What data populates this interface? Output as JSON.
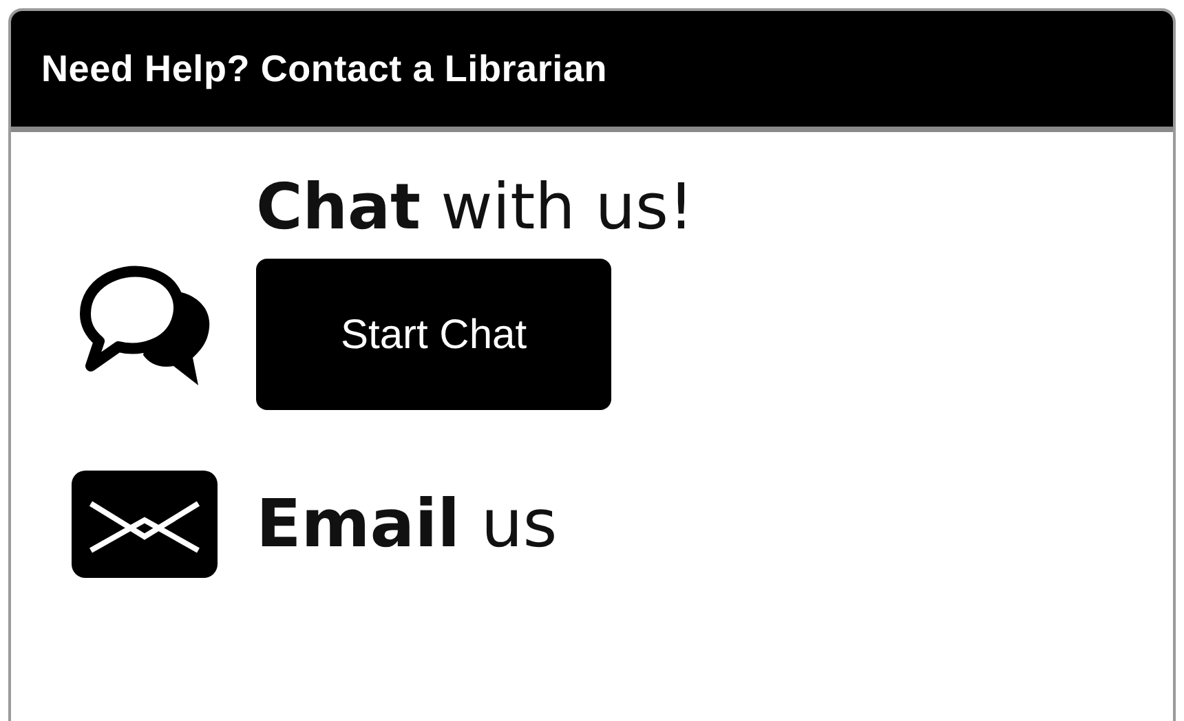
{
  "header": {
    "title": "Need Help? Contact a Librarian"
  },
  "chat": {
    "heading": "**Chat** with us!",
    "button": "Start Chat"
  },
  "email": {
    "heading": "**Email** us"
  }
}
